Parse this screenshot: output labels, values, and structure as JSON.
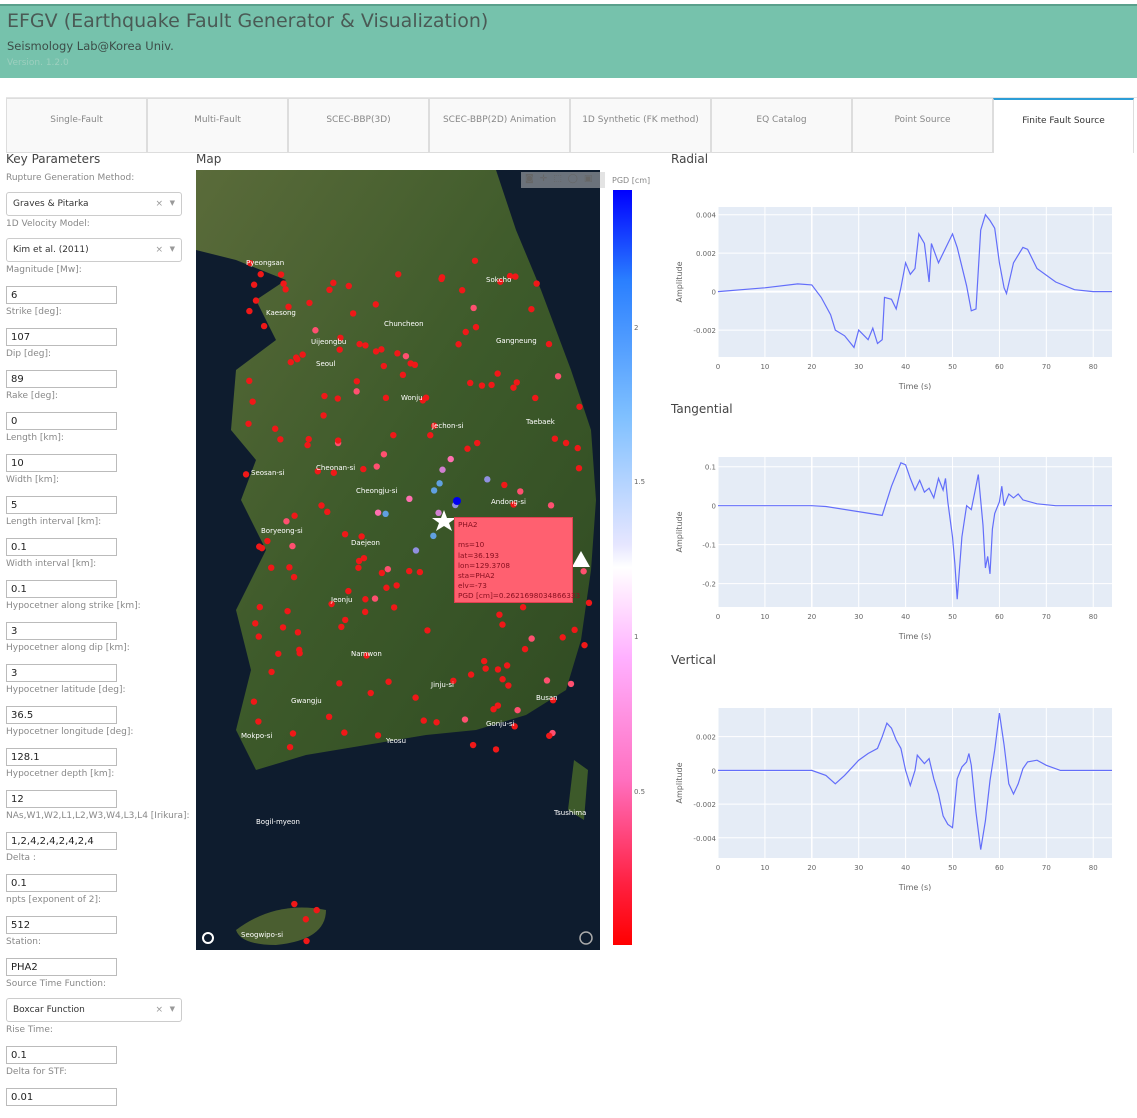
{
  "header": {
    "title": "EFGV (Earthquake Fault Generator & Visualization)",
    "subtitle": "Seismology Lab@Korea Univ.",
    "version": "Version. 1.2.0"
  },
  "tabs": [
    {
      "label": "Single-Fault"
    },
    {
      "label": "Multi-Fault"
    },
    {
      "label": "SCEC-BBP(3D)"
    },
    {
      "label": "SCEC-BBP(2D) Animation"
    },
    {
      "label": "1D Synthetic (FK method)"
    },
    {
      "label": "EQ Catalog"
    },
    {
      "label": "Point Source"
    },
    {
      "label": "Finite Fault Source",
      "active": true
    }
  ],
  "params": {
    "heading": "Key Parameters",
    "fields": [
      {
        "label": "Rupture Generation Method:",
        "type": "select",
        "value": "Graves & Pitarka"
      },
      {
        "label": "1D Velocity Model:",
        "type": "select",
        "value": "Kim et al. (2011)"
      },
      {
        "label": "Magnitude [Mw]:",
        "value": "6"
      },
      {
        "label": "Strike [deg]:",
        "value": "107"
      },
      {
        "label": "Dip [deg]:",
        "value": "89"
      },
      {
        "label": "Rake [deg]:",
        "value": "0"
      },
      {
        "label": "Length [km]:",
        "value": "10"
      },
      {
        "label": "Width [km]:",
        "value": "5"
      },
      {
        "label": "Length interval [km]:",
        "value": "0.1"
      },
      {
        "label": "Width interval [km]:",
        "value": "0.1"
      },
      {
        "label": "Hypocetner along strike [km]:",
        "value": "3"
      },
      {
        "label": "Hypocetner along dip [km]:",
        "value": "3"
      },
      {
        "label": "Hypocetner latitude [deg]:",
        "value": "36.5"
      },
      {
        "label": "Hypocetner longitude [deg]:",
        "value": "128.1"
      },
      {
        "label": "Hypocetner depth [km]:",
        "value": "12"
      },
      {
        "label": "NAs,W1,W2,L1,L2,W3,W4,L3,L4 [Irikura]:",
        "value": "1,2,4,2,4,2,4,2,4"
      },
      {
        "label": "Delta :",
        "value": "0.1"
      },
      {
        "label": "npts [exponent of 2]:",
        "value": "512"
      },
      {
        "label": "Station:",
        "value": "PHA2"
      },
      {
        "label": "Source Time Function:",
        "type": "select",
        "value": "Boxcar Function"
      },
      {
        "label": "Rise Time:",
        "value": "0.1"
      },
      {
        "label": "Delta for STF:",
        "value": "0.01"
      }
    ]
  },
  "map": {
    "heading": "Map",
    "colorbar_title": "PGD [cm]",
    "colorbar_ticks": [
      "2",
      "1.5",
      "1",
      "0.5"
    ],
    "tooltip": {
      "station": "PHA2",
      "lines": "ms=10\nlat=36.193\nlon=129.3708\nsta=PHA2\nelv=-73\nPGD [cm]=0.2621698034866333",
      "color": "#ff6070"
    },
    "places": [
      "Pyeongsan",
      "Kaesong",
      "Sokcho",
      "Chuncheon",
      "Uijeongbu",
      "Seoul",
      "Gangneung",
      "Wonju",
      "Jechon-si",
      "Taebaek",
      "Seosan-si",
      "Cheonan-si",
      "Cheongju-si",
      "Andong-si",
      "Boryeong-si",
      "Daejeon",
      "Jeonju",
      "Namwon",
      "Jinju-si",
      "Busan",
      "Gwangju",
      "Mokpo-si",
      "Yeosu",
      "Gonju-si",
      "Tsushima",
      "Bogil-myeon",
      "Seogwipo-si"
    ]
  },
  "chart_data": [
    {
      "type": "line",
      "title": "Radial",
      "xlabel": "Time (s)",
      "ylabel": "Amplitude",
      "xlim": [
        0,
        84
      ],
      "ylim": [
        -0.0034,
        0.0044
      ],
      "xticks": [
        0,
        10,
        20,
        30,
        40,
        50,
        60,
        70,
        80
      ],
      "yticks": [
        -0.002,
        0,
        0.002,
        0.004
      ],
      "ytick_labels": [
        "-0.002",
        "0",
        "0.002",
        "0.004"
      ],
      "color": "#636efa",
      "grid": true,
      "x": [
        0,
        10,
        17,
        20,
        22,
        24,
        25,
        27,
        29,
        30,
        32,
        33,
        34,
        35,
        35.5,
        37,
        38,
        39,
        40,
        41,
        42,
        42.8,
        44,
        45,
        45.5,
        47,
        48,
        50,
        51,
        53,
        54,
        55,
        56,
        57,
        58,
        59,
        60,
        61,
        61.5,
        63,
        65,
        66,
        68,
        72,
        76,
        80,
        84
      ],
      "y": [
        0,
        0.0002,
        0.0004,
        0.00035,
        -0.0003,
        -0.0012,
        -0.002,
        -0.0023,
        -0.0029,
        -0.002,
        -0.0025,
        -0.0019,
        -0.0027,
        -0.0025,
        -0.0003,
        -0.0004,
        -0.0009,
        0.0002,
        0.0015,
        0.0009,
        0.0012,
        0.003,
        0.0025,
        0.0005,
        0.0025,
        0.0015,
        0.002,
        0.003,
        0.0023,
        0.0003,
        -0.001,
        -0.0009,
        0.0032,
        0.004,
        0.0037,
        0.0033,
        0.0015,
        0.0002,
        -0.0001,
        0.0015,
        0.0023,
        0.0022,
        0.0012,
        0.0005,
        0.0001,
        0,
        0
      ]
    },
    {
      "type": "line",
      "title": "Tangential",
      "xlabel": "Time (s)",
      "ylabel": "Amplitude",
      "xlim": [
        0,
        84
      ],
      "ylim": [
        -0.26,
        0.125
      ],
      "xticks": [
        0,
        10,
        20,
        30,
        40,
        50,
        60,
        70,
        80
      ],
      "yticks": [
        -0.2,
        -0.1,
        0,
        0.1
      ],
      "ytick_labels": [
        "-0.2",
        "-0.1",
        "0",
        "0.1"
      ],
      "color": "#636efa",
      "grid": true,
      "x": [
        0,
        20,
        23,
        35,
        37,
        39,
        40,
        41,
        42,
        43,
        44,
        45,
        46,
        47,
        48,
        48.5,
        49,
        50,
        50.5,
        51,
        52,
        53,
        54,
        55,
        55.5,
        56.5,
        57,
        57.5,
        58,
        58.5,
        59,
        60,
        60.5,
        61,
        62,
        63,
        64,
        65,
        68,
        72,
        84
      ],
      "y": [
        0,
        0,
        -0.002,
        -0.025,
        0.05,
        0.11,
        0.105,
        0.07,
        0.04,
        0.065,
        0.035,
        0.045,
        0.02,
        0.07,
        0.04,
        0.07,
        0.01,
        -0.08,
        -0.15,
        -0.24,
        -0.08,
        0,
        -0.01,
        0.05,
        0.08,
        -0.05,
        -0.16,
        -0.13,
        -0.175,
        -0.06,
        -0.02,
        0.01,
        0.05,
        0,
        0.03,
        0.02,
        0.03,
        0.015,
        0.005,
        0,
        0
      ]
    },
    {
      "type": "line",
      "title": "Vertical",
      "xlabel": "Time (s)",
      "ylabel": "Amplitude",
      "xlim": [
        0,
        84
      ],
      "ylim": [
        -0.0052,
        0.0037
      ],
      "xticks": [
        0,
        10,
        20,
        30,
        40,
        50,
        60,
        70,
        80
      ],
      "yticks": [
        -0.004,
        -0.002,
        0,
        0.002
      ],
      "ytick_labels": [
        "-0.004",
        "-0.002",
        "0",
        "0.002"
      ],
      "color": "#636efa",
      "grid": true,
      "x": [
        0,
        20,
        23,
        25,
        27,
        29,
        30,
        32,
        34,
        35,
        36,
        37,
        38,
        39,
        40,
        41,
        42,
        42.5,
        44,
        45,
        46,
        47,
        48,
        49,
        50,
        51,
        52,
        53,
        53.5,
        54,
        55,
        56,
        57,
        58,
        59,
        60,
        61,
        62,
        63,
        64,
        65,
        66,
        68,
        70,
        73,
        84
      ],
      "y": [
        0,
        0,
        -0.0003,
        -0.0008,
        -0.0003,
        0.0003,
        0.0006,
        0.001,
        0.0013,
        0.002,
        0.0028,
        0.0025,
        0.0018,
        0.0013,
        0,
        -0.0009,
        0,
        0.0009,
        0.0004,
        0.0007,
        -0.0005,
        -0.0014,
        -0.0027,
        -0.0032,
        -0.0034,
        -0.0005,
        0.0002,
        0.0005,
        0.001,
        0.0003,
        -0.0025,
        -0.0047,
        -0.003,
        -0.0006,
        0.0012,
        0.0034,
        0.0015,
        -0.0008,
        -0.0014,
        -0.0008,
        0.0001,
        0.0005,
        0.0006,
        0.0003,
        0,
        0
      ]
    }
  ]
}
